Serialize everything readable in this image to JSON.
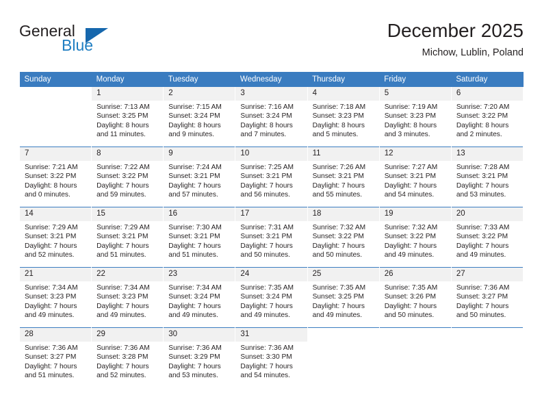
{
  "logo": {
    "word1": "General",
    "word2": "Blue",
    "triangle_color": "#1667ad",
    "blue_color": "#1f7ec2"
  },
  "header": {
    "title": "December 2025",
    "subtitle": "Michow, Lublin, Poland"
  },
  "theme": {
    "header_row_bg": "#3a7cc0",
    "daynum_bg": "#f1f1f1",
    "text": "#231f20"
  },
  "weekday_headers": [
    "Sunday",
    "Monday",
    "Tuesday",
    "Wednesday",
    "Thursday",
    "Friday",
    "Saturday"
  ],
  "weeks": [
    [
      {
        "day": "",
        "sunrise": "",
        "sunset": "",
        "daylight1": "",
        "daylight2": ""
      },
      {
        "day": "1",
        "sunrise": "Sunrise: 7:13 AM",
        "sunset": "Sunset: 3:25 PM",
        "daylight1": "Daylight: 8 hours",
        "daylight2": "and 11 minutes."
      },
      {
        "day": "2",
        "sunrise": "Sunrise: 7:15 AM",
        "sunset": "Sunset: 3:24 PM",
        "daylight1": "Daylight: 8 hours",
        "daylight2": "and 9 minutes."
      },
      {
        "day": "3",
        "sunrise": "Sunrise: 7:16 AM",
        "sunset": "Sunset: 3:24 PM",
        "daylight1": "Daylight: 8 hours",
        "daylight2": "and 7 minutes."
      },
      {
        "day": "4",
        "sunrise": "Sunrise: 7:18 AM",
        "sunset": "Sunset: 3:23 PM",
        "daylight1": "Daylight: 8 hours",
        "daylight2": "and 5 minutes."
      },
      {
        "day": "5",
        "sunrise": "Sunrise: 7:19 AM",
        "sunset": "Sunset: 3:23 PM",
        "daylight1": "Daylight: 8 hours",
        "daylight2": "and 3 minutes."
      },
      {
        "day": "6",
        "sunrise": "Sunrise: 7:20 AM",
        "sunset": "Sunset: 3:22 PM",
        "daylight1": "Daylight: 8 hours",
        "daylight2": "and 2 minutes."
      }
    ],
    [
      {
        "day": "7",
        "sunrise": "Sunrise: 7:21 AM",
        "sunset": "Sunset: 3:22 PM",
        "daylight1": "Daylight: 8 hours",
        "daylight2": "and 0 minutes."
      },
      {
        "day": "8",
        "sunrise": "Sunrise: 7:22 AM",
        "sunset": "Sunset: 3:22 PM",
        "daylight1": "Daylight: 7 hours",
        "daylight2": "and 59 minutes."
      },
      {
        "day": "9",
        "sunrise": "Sunrise: 7:24 AM",
        "sunset": "Sunset: 3:21 PM",
        "daylight1": "Daylight: 7 hours",
        "daylight2": "and 57 minutes."
      },
      {
        "day": "10",
        "sunrise": "Sunrise: 7:25 AM",
        "sunset": "Sunset: 3:21 PM",
        "daylight1": "Daylight: 7 hours",
        "daylight2": "and 56 minutes."
      },
      {
        "day": "11",
        "sunrise": "Sunrise: 7:26 AM",
        "sunset": "Sunset: 3:21 PM",
        "daylight1": "Daylight: 7 hours",
        "daylight2": "and 55 minutes."
      },
      {
        "day": "12",
        "sunrise": "Sunrise: 7:27 AM",
        "sunset": "Sunset: 3:21 PM",
        "daylight1": "Daylight: 7 hours",
        "daylight2": "and 54 minutes."
      },
      {
        "day": "13",
        "sunrise": "Sunrise: 7:28 AM",
        "sunset": "Sunset: 3:21 PM",
        "daylight1": "Daylight: 7 hours",
        "daylight2": "and 53 minutes."
      }
    ],
    [
      {
        "day": "14",
        "sunrise": "Sunrise: 7:29 AM",
        "sunset": "Sunset: 3:21 PM",
        "daylight1": "Daylight: 7 hours",
        "daylight2": "and 52 minutes."
      },
      {
        "day": "15",
        "sunrise": "Sunrise: 7:29 AM",
        "sunset": "Sunset: 3:21 PM",
        "daylight1": "Daylight: 7 hours",
        "daylight2": "and 51 minutes."
      },
      {
        "day": "16",
        "sunrise": "Sunrise: 7:30 AM",
        "sunset": "Sunset: 3:21 PM",
        "daylight1": "Daylight: 7 hours",
        "daylight2": "and 51 minutes."
      },
      {
        "day": "17",
        "sunrise": "Sunrise: 7:31 AM",
        "sunset": "Sunset: 3:21 PM",
        "daylight1": "Daylight: 7 hours",
        "daylight2": "and 50 minutes."
      },
      {
        "day": "18",
        "sunrise": "Sunrise: 7:32 AM",
        "sunset": "Sunset: 3:22 PM",
        "daylight1": "Daylight: 7 hours",
        "daylight2": "and 50 minutes."
      },
      {
        "day": "19",
        "sunrise": "Sunrise: 7:32 AM",
        "sunset": "Sunset: 3:22 PM",
        "daylight1": "Daylight: 7 hours",
        "daylight2": "and 49 minutes."
      },
      {
        "day": "20",
        "sunrise": "Sunrise: 7:33 AM",
        "sunset": "Sunset: 3:22 PM",
        "daylight1": "Daylight: 7 hours",
        "daylight2": "and 49 minutes."
      }
    ],
    [
      {
        "day": "21",
        "sunrise": "Sunrise: 7:34 AM",
        "sunset": "Sunset: 3:23 PM",
        "daylight1": "Daylight: 7 hours",
        "daylight2": "and 49 minutes."
      },
      {
        "day": "22",
        "sunrise": "Sunrise: 7:34 AM",
        "sunset": "Sunset: 3:23 PM",
        "daylight1": "Daylight: 7 hours",
        "daylight2": "and 49 minutes."
      },
      {
        "day": "23",
        "sunrise": "Sunrise: 7:34 AM",
        "sunset": "Sunset: 3:24 PM",
        "daylight1": "Daylight: 7 hours",
        "daylight2": "and 49 minutes."
      },
      {
        "day": "24",
        "sunrise": "Sunrise: 7:35 AM",
        "sunset": "Sunset: 3:24 PM",
        "daylight1": "Daylight: 7 hours",
        "daylight2": "and 49 minutes."
      },
      {
        "day": "25",
        "sunrise": "Sunrise: 7:35 AM",
        "sunset": "Sunset: 3:25 PM",
        "daylight1": "Daylight: 7 hours",
        "daylight2": "and 49 minutes."
      },
      {
        "day": "26",
        "sunrise": "Sunrise: 7:35 AM",
        "sunset": "Sunset: 3:26 PM",
        "daylight1": "Daylight: 7 hours",
        "daylight2": "and 50 minutes."
      },
      {
        "day": "27",
        "sunrise": "Sunrise: 7:36 AM",
        "sunset": "Sunset: 3:27 PM",
        "daylight1": "Daylight: 7 hours",
        "daylight2": "and 50 minutes."
      }
    ],
    [
      {
        "day": "28",
        "sunrise": "Sunrise: 7:36 AM",
        "sunset": "Sunset: 3:27 PM",
        "daylight1": "Daylight: 7 hours",
        "daylight2": "and 51 minutes."
      },
      {
        "day": "29",
        "sunrise": "Sunrise: 7:36 AM",
        "sunset": "Sunset: 3:28 PM",
        "daylight1": "Daylight: 7 hours",
        "daylight2": "and 52 minutes."
      },
      {
        "day": "30",
        "sunrise": "Sunrise: 7:36 AM",
        "sunset": "Sunset: 3:29 PM",
        "daylight1": "Daylight: 7 hours",
        "daylight2": "and 53 minutes."
      },
      {
        "day": "31",
        "sunrise": "Sunrise: 7:36 AM",
        "sunset": "Sunset: 3:30 PM",
        "daylight1": "Daylight: 7 hours",
        "daylight2": "and 54 minutes."
      },
      {
        "day": "",
        "sunrise": "",
        "sunset": "",
        "daylight1": "",
        "daylight2": ""
      },
      {
        "day": "",
        "sunrise": "",
        "sunset": "",
        "daylight1": "",
        "daylight2": ""
      },
      {
        "day": "",
        "sunrise": "",
        "sunset": "",
        "daylight1": "",
        "daylight2": ""
      }
    ]
  ]
}
